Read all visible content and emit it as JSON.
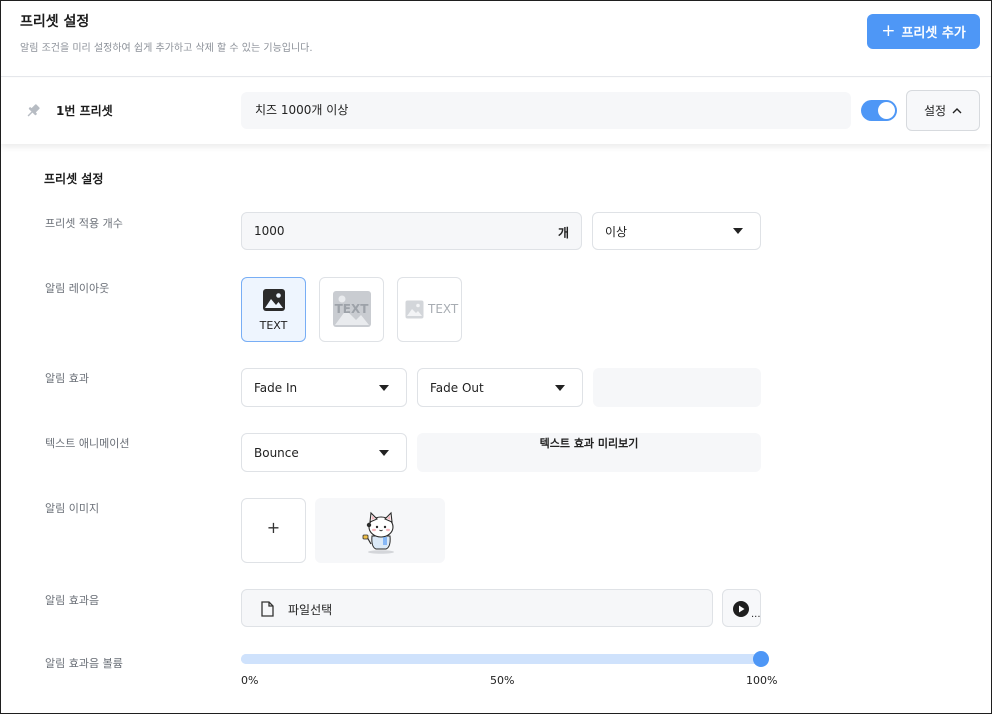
{
  "header": {
    "title": "프리셋 설정",
    "description": "알림 조건을 미리 설정하여 쉽게 추가하고 삭제 할 수 있는 기능입니다.",
    "add_button": {
      "label": "프리셋 추가",
      "icon": "plus-icon"
    }
  },
  "preset": {
    "name": "1번 프리셋",
    "summary": "치즈 1000개 이상",
    "enabled": true,
    "settings_button": "설정"
  },
  "panel": {
    "title": "프리셋 설정",
    "apply_count": {
      "label": "프리셋 적용 개수",
      "value": "1000",
      "unit": "개",
      "condition": "이상"
    },
    "layout": {
      "label": "알림 레이아웃",
      "options": [
        {
          "text": "TEXT",
          "selected": true
        },
        {
          "text": "TEXT",
          "selected": false
        },
        {
          "text": "TEXT",
          "selected": false
        }
      ]
    },
    "effect": {
      "label": "알림 효과",
      "in": "Fade In",
      "out": "Fade Out"
    },
    "text_animation": {
      "label": "텍스트 애니메이션",
      "value": "Bounce",
      "preview": "텍스트 효과 미리보기"
    },
    "image": {
      "label": "알림 이미지",
      "add_icon": "plus-icon"
    },
    "sound": {
      "label": "알림 효과음",
      "file": "파일선택",
      "play_icon": "play-icon",
      "play_overflow": "..."
    },
    "volume": {
      "label": "알림 효과음 볼륨",
      "value": 100,
      "ticks": [
        "0%",
        "50%",
        "100%"
      ]
    }
  },
  "colors": {
    "accent": "#4e97f6",
    "track": "#cfe2fc",
    "field_bg": "#f6f7f9"
  }
}
